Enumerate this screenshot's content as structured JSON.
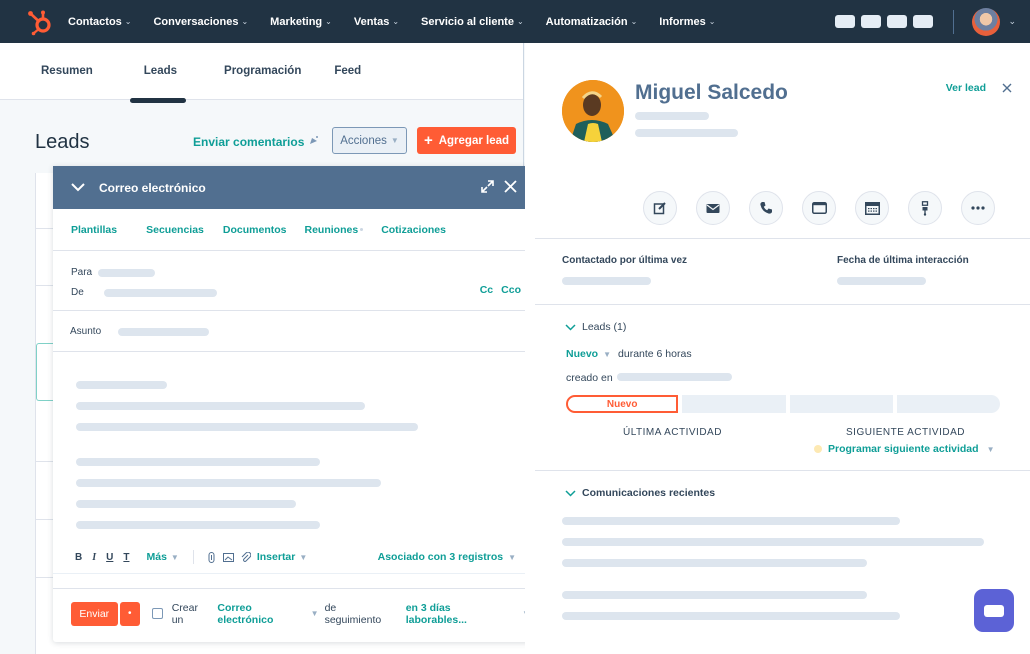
{
  "topnav": {
    "items": [
      {
        "label": "Contactos"
      },
      {
        "label": "Conversaciones"
      },
      {
        "label": "Marketing"
      },
      {
        "label": "Ventas"
      },
      {
        "label": "Servicio al cliente"
      },
      {
        "label": "Automatización"
      },
      {
        "label": "Informes"
      }
    ],
    "chevron": "⌄",
    "logo_icon": "hubspot-sprocket-icon",
    "brand_color": "#ff5c35"
  },
  "tabs": [
    {
      "label": "Resumen"
    },
    {
      "label": "Leads",
      "active": true
    },
    {
      "label": "Programación"
    },
    {
      "label": "Feed"
    }
  ],
  "page": {
    "title": "Leads",
    "feedback_link": "Enviar comentarios",
    "actions_label": "Acciones",
    "add_lead_label": "Agregar lead",
    "add_icon": "+"
  },
  "composer": {
    "title": "Correo electrónico",
    "tabs": [
      {
        "label": "Plantillas"
      },
      {
        "label": "Secuencias"
      },
      {
        "label": "Documentos"
      },
      {
        "label": "Reuniones"
      },
      {
        "label": "Cotizaciones"
      }
    ],
    "to_label": "Para",
    "from_label": "De",
    "cc_label": "Cc",
    "bcc_label": "Cco",
    "subject_label": "Asunto",
    "toolbar": {
      "bold": "B",
      "italic": "I",
      "underline": "U",
      "clear_format": "T",
      "more_label": "Más",
      "insert_label": "Insertar",
      "associated_label": "Asociado con 3 registros"
    },
    "footer": {
      "send_label": "Enviar",
      "create_prefix": "Crear un",
      "followup_type": "Correo electrónico",
      "followup_middle": "de seguimiento",
      "followup_when": "en 3 días laborables..."
    }
  },
  "contact": {
    "name": "Miguel Salcedo",
    "view_lead_label": "Ver lead",
    "action_buttons": [
      {
        "icon": "note-icon"
      },
      {
        "icon": "email-icon"
      },
      {
        "icon": "phone-icon"
      },
      {
        "icon": "task-icon"
      },
      {
        "icon": "meeting-calendar-icon"
      },
      {
        "icon": "sequence-icon"
      },
      {
        "icon": "more-icon"
      }
    ],
    "properties": {
      "last_contacted_label": "Contactado por última vez",
      "last_engagement_label": "Fecha de última interacción"
    },
    "leads_section": {
      "title": "Leads (1)",
      "status": "Nuevo",
      "duration": "durante 6 horas",
      "created_label": "creado en",
      "pipeline_active_stage": "Nuevo",
      "last_activity_label": "ÚLTIMA ACTIVIDAD",
      "next_activity_label": "SIGUIENTE ACTIVIDAD",
      "schedule_label": "Programar siguiente actividad"
    },
    "communications_section": {
      "title": "Comunicaciones recientes"
    }
  }
}
